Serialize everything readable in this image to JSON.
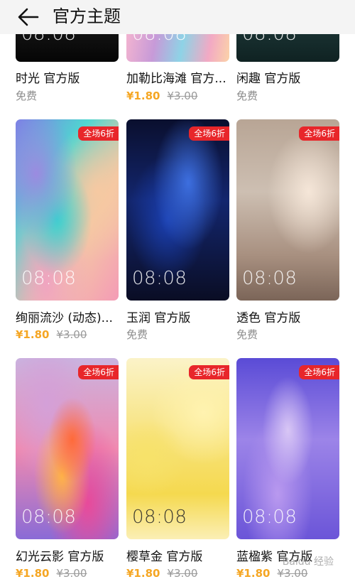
{
  "header": {
    "title": "官方主题",
    "back_icon": "arrow-left-icon"
  },
  "badge_text": "全场6折",
  "time_text": "08:08",
  "colors": {
    "accent_price": "#f5a623",
    "badge": "#e8262a",
    "muted": "#9a9a9a"
  },
  "themes": [
    {
      "name": "时光 官方版",
      "price": "",
      "original_price": "",
      "free_label": "免费",
      "badge": false
    },
    {
      "name": "加勒比海滩 官方...",
      "price": "¥1.80",
      "original_price": "¥3.00",
      "free_label": "",
      "badge": false
    },
    {
      "name": "闲趣 官方版",
      "price": "",
      "original_price": "",
      "free_label": "免费",
      "badge": false
    },
    {
      "name": "绚丽流沙 (动态)...",
      "price": "¥1.80",
      "original_price": "¥3.00",
      "free_label": "",
      "badge": true
    },
    {
      "name": "玉润 官方版",
      "price": "",
      "original_price": "",
      "free_label": "免费",
      "badge": true
    },
    {
      "name": "透色 官方版",
      "price": "",
      "original_price": "",
      "free_label": "免费",
      "badge": true
    },
    {
      "name": "幻光云影 官方版",
      "price": "¥1.80",
      "original_price": "¥3.00",
      "free_label": "",
      "badge": true
    },
    {
      "name": "樱草金 官方版",
      "price": "¥1.80",
      "original_price": "¥3.00",
      "free_label": "",
      "badge": true
    },
    {
      "name": "蓝楹紫 官方版",
      "price": "¥1.80",
      "original_price": "¥3.00",
      "free_label": "",
      "badge": true
    }
  ],
  "watermark": "Baidu 经验"
}
